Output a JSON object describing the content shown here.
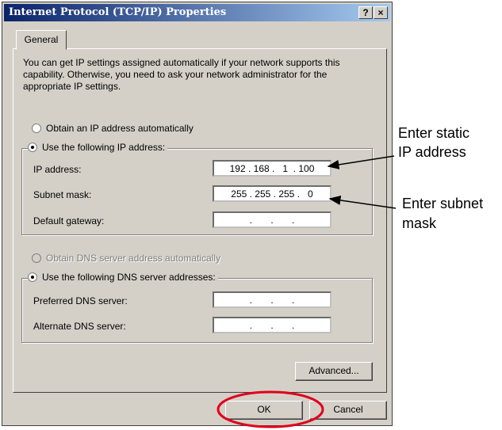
{
  "window": {
    "title": "Internet Protocol (TCP/IP) Properties",
    "help_label": "?",
    "close_label": "×"
  },
  "tabs": [
    {
      "label": "General"
    }
  ],
  "description": "You can get IP settings assigned automatically if your network supports this capability. Otherwise, you need to ask your network administrator for the appropriate IP settings.",
  "ip_section": {
    "auto_option": {
      "label": "Obtain an IP address automatically",
      "selected": false
    },
    "manual_option": {
      "label": "Use the following IP address:",
      "selected": true
    },
    "fields": [
      {
        "label": "IP address:",
        "value": "192 . 168 .   1  . 100"
      },
      {
        "label": "Subnet mask:",
        "value": "255 . 255 . 255 .   0"
      },
      {
        "label": "Default gateway:",
        "value": "   .       .       .   "
      }
    ]
  },
  "dns_section": {
    "auto_option": {
      "label": "Obtain DNS server address automatically",
      "selected": false,
      "disabled": true
    },
    "manual_option": {
      "label": "Use the following DNS server addresses:",
      "selected": true
    },
    "fields": [
      {
        "label": "Preferred DNS server:",
        "value": "   .       .       .   "
      },
      {
        "label": "Alternate DNS server:",
        "value": "   .       .       .   "
      }
    ]
  },
  "buttons": {
    "advanced": "Advanced...",
    "ok": "OK",
    "cancel": "Cancel"
  },
  "annotations": {
    "static_ip_line1": "Enter static",
    "static_ip_line2": "IP address",
    "subnet_line1": "Enter subnet",
    "subnet_line2": "mask"
  },
  "colors": {
    "dialog_face": "#d4d0c8",
    "titlebar_start": "#0a246a",
    "titlebar_end": "#a6caf0",
    "highlight_circle": "#e0001b"
  }
}
